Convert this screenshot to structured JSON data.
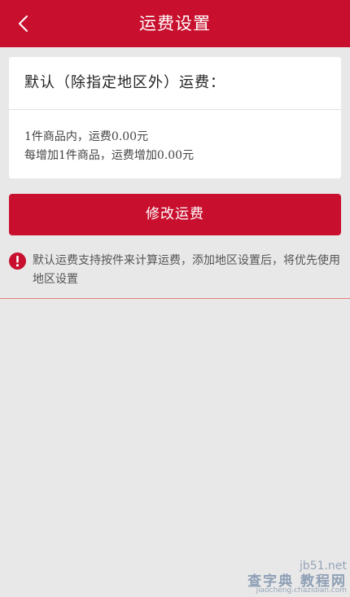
{
  "header": {
    "title": "运费设置",
    "back_icon": "chevron-left-icon"
  },
  "default_fee": {
    "title": "默认（除指定地区外）运费：",
    "line1": "1件商品内，运费0.00元",
    "line2": "每增加1件商品，运费增加0.00元"
  },
  "actions": {
    "modify_label": "修改运费"
  },
  "notice": {
    "icon": "info-icon",
    "text": "默认运费支持按件来计算运费，添加地区设置后，将优先使用地区设置"
  },
  "watermark": {
    "line1": "jb51.net",
    "line2": "查字典 教程网",
    "line3": "jiaocheng.chazidian.com"
  },
  "colors": {
    "brand_red": "#c8102e",
    "background": "#e8e8e8",
    "card": "#ffffff"
  }
}
